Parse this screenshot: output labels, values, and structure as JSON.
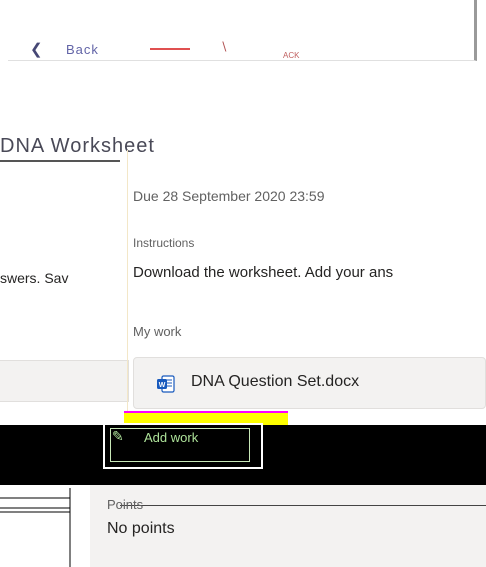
{
  "back": {
    "icon": "chevron-left-icon",
    "label": "Back",
    "glitch_text": "ACK"
  },
  "title": {
    "text": "DNA Worksheet"
  },
  "left_column": {
    "instructions_fragment": "swers.  Sav"
  },
  "assignment": {
    "due": "Due 28 September 2020 23:59",
    "instructions_label": "Instructions",
    "instructions_text": "Download the worksheet. Add your ans",
    "my_work_label": "My work",
    "file": {
      "name": "DNA Question Set.docx",
      "icon": "word-file-icon"
    },
    "add_work_label": "Add work",
    "add_work_icon": "paperclip-icon"
  },
  "points": {
    "label": "Points",
    "value": "No points"
  },
  "colors": {
    "accent": "#6264a7",
    "word_blue": "#185abd",
    "glitch_yellow": "#ffff00",
    "glitch_magenta": "#ff00ff"
  }
}
